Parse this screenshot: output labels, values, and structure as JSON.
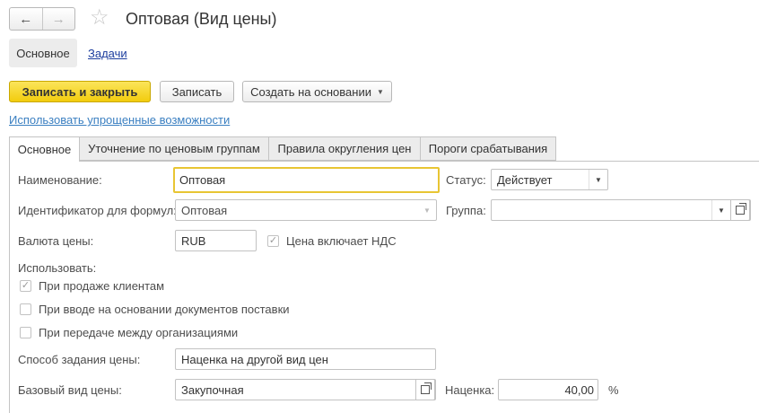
{
  "header": {
    "back_icon": "←",
    "forward_icon": "→",
    "star_icon": "☆",
    "title": "Оптовая (Вид цены)"
  },
  "sections": {
    "main": "Основное",
    "tasks": "Задачи"
  },
  "toolbar": {
    "save_close": "Записать и закрыть",
    "save": "Записать",
    "create_based": "Создать на основании",
    "caret": "▼"
  },
  "simplified_link": "Использовать упрощенные возможности",
  "tabs": [
    {
      "label": "Основное"
    },
    {
      "label": "Уточнение по ценовым группам"
    },
    {
      "label": "Правила округления цен"
    },
    {
      "label": "Пороги срабатывания"
    }
  ],
  "form": {
    "name_label": "Наименование:",
    "name_value": "Оптовая",
    "status_label": "Статус:",
    "status_value": "Действует",
    "formula_id_label": "Идентификатор для формул:",
    "formula_id_value": "Оптовая",
    "group_label": "Группа:",
    "group_value": "",
    "currency_label": "Валюта цены:",
    "currency_value": "RUB",
    "vat_label": "Цена включает НДС",
    "vat_checked": true,
    "use_label": "Использовать:",
    "use_options": [
      {
        "label": "При продаже клиентам",
        "checked": true
      },
      {
        "label": "При вводе на основании документов поставки",
        "checked": false
      },
      {
        "label": "При передаче между организациями",
        "checked": false
      }
    ],
    "price_method_label": "Способ задания цены:",
    "price_method_value": "Наценка на другой вид цен",
    "base_price_label": "Базовый вид цены:",
    "base_price_value": "Закупочная",
    "markup_label": "Наценка:",
    "markup_value": "40,00",
    "percent_sign": "%"
  },
  "check_mark": "✓",
  "dropdown_caret": "▼"
}
